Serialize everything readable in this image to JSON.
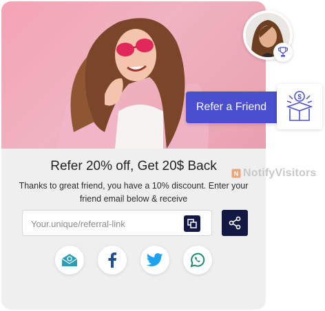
{
  "widget": {
    "headline": "Refer 20% off, Get 20$ Back",
    "subtext": "Thanks to great friend, you have a 10% discount. Enter your friend email below & receive",
    "link_placeholder": "Your.unique/referral-link",
    "link_value": "",
    "copy_icon": "copy-icon",
    "share_icon": "share-icon"
  },
  "social": [
    {
      "name": "email",
      "icon": "email-icon",
      "color": "#2a9fb5"
    },
    {
      "name": "facebook",
      "icon": "facebook-icon",
      "color": "#1d4f91"
    },
    {
      "name": "twitter",
      "icon": "twitter-icon",
      "color": "#1da1f2"
    },
    {
      "name": "whatsapp",
      "icon": "whatsapp-icon",
      "color": "#1a8b6f"
    }
  ],
  "refer_button": {
    "label": "Refer a Friend",
    "color": "#4a4fd0"
  },
  "brand": {
    "name": "NotifyVisitors"
  },
  "colors": {
    "dark_button": "#131845",
    "hero_pink": "#f4a3b4",
    "card_bg": "#efefef"
  }
}
